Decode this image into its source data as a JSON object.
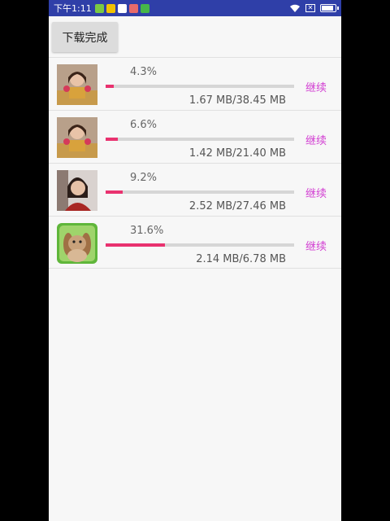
{
  "status_bar": {
    "time": "下午1:11",
    "sim_label": "✕",
    "battery_level": 0.85
  },
  "done_button": {
    "label": "下载完成"
  },
  "downloads": [
    {
      "percent_text": "4.3%",
      "progress": 0.043,
      "size_text": "1.67 MB/38.45 MB",
      "action": "继续",
      "thumb": "girl-costume"
    },
    {
      "percent_text": "6.6%",
      "progress": 0.066,
      "size_text": "1.42 MB/21.40 MB",
      "action": "继续",
      "thumb": "girl-costume"
    },
    {
      "percent_text": "9.2%",
      "progress": 0.092,
      "size_text": "2.52 MB/27.46 MB",
      "action": "继续",
      "thumb": "woman-portrait"
    },
    {
      "percent_text": "31.6%",
      "progress": 0.316,
      "size_text": "2.14 MB/6.78 MB",
      "action": "继续",
      "thumb": "rabbit"
    }
  ],
  "colors": {
    "status_bar": "#2f3fa8",
    "progress_fill": "#e9326f",
    "progress_track": "#d6d6d6",
    "continue_text": "#d23fd2"
  }
}
